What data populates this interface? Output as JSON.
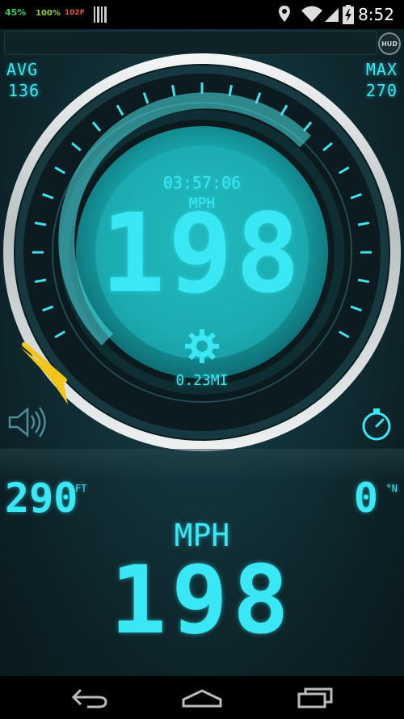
{
  "status_bar": {
    "battery_percent": "45%",
    "signal_percent": "100%",
    "temperature": "102F",
    "time": "8:52",
    "colors": {
      "battery": "#2fd05a",
      "signal": "#9ad13b",
      "temperature": "#e05a3a"
    },
    "icons": [
      "barcode-icon",
      "location-icon",
      "wifi-icon",
      "cellular-icon",
      "battery-charging-icon"
    ]
  },
  "top_bar": {
    "hud_button_label": "HUD"
  },
  "stats": {
    "avg_label": "AVG",
    "avg_value": "136",
    "max_label": "MAX",
    "max_value": "270"
  },
  "gauge": {
    "trip_time": "03:57:06",
    "unit": "MPH",
    "speed": "198",
    "distance": "0.23MI",
    "settings_icon": "gear-icon",
    "colors": {
      "accent": "#39e8f4",
      "needle": "#f2c51a",
      "dial_face": "#1aa8ad"
    }
  },
  "controls": {
    "sound_icon": "speaker-icon",
    "timer_icon": "stopwatch-icon"
  },
  "readouts": {
    "altitude_value": "290",
    "altitude_unit": "FT",
    "heading_value": "0",
    "heading_unit": "°N",
    "speed_label": "MPH",
    "speed_value": "198"
  },
  "nav_bar": {
    "icons": [
      "back-icon",
      "home-icon",
      "recents-icon"
    ]
  }
}
